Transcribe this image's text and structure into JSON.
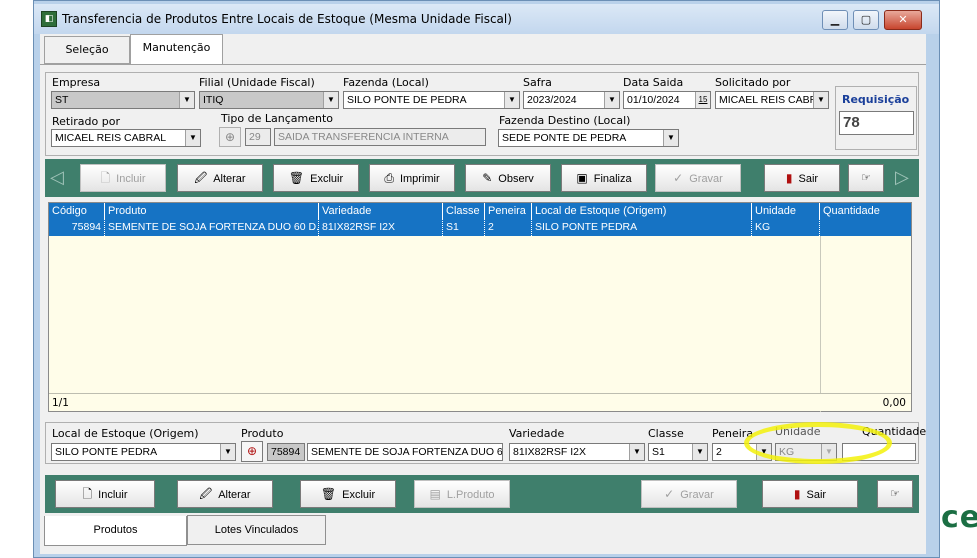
{
  "window": {
    "title": "Transferencia de Produtos Entre Locais de Estoque (Mesma Unidade Fiscal)",
    "minimize": "▁",
    "maximize": "▢",
    "close": "✕"
  },
  "tabs": [
    {
      "label": "Seleção"
    },
    {
      "label": "Manutenção"
    }
  ],
  "header": {
    "empresa": {
      "label": "Empresa",
      "value": "ST"
    },
    "filial": {
      "label": "Filial (Unidade Fiscal)",
      "value": "ITIQ"
    },
    "fazenda": {
      "label": "Fazenda (Local)",
      "value": "SILO PONTE DE PEDRA"
    },
    "safra": {
      "label": "Safra",
      "value": "2023/2024"
    },
    "data_saida": {
      "label": "Data Saida",
      "value": "01/10/2024",
      "cal": "15"
    },
    "solicitado": {
      "label": "Solicitado por",
      "value": "MICAEL REIS CABR"
    },
    "requisicao": {
      "label": "Requisição",
      "value": "78"
    },
    "retirado": {
      "label": "Retirado por",
      "value": "MICAEL REIS CABRAL"
    },
    "tipo": {
      "label": "Tipo de Lançamento",
      "code": "29",
      "value": "SAIDA TRANSFERENCIA INTERNA"
    },
    "destino": {
      "label": "Fazenda Destino  (Local)",
      "value": "SEDE PONTE DE PEDRA"
    }
  },
  "toolbar1": {
    "incluir": "Incluir",
    "alterar": "Alterar",
    "excluir": "Excluir",
    "imprimir": "Imprimir",
    "observ": "Observ",
    "finaliza": "Finaliza",
    "gravar": "Gravar",
    "sair": "Sair"
  },
  "grid": {
    "columns": [
      "Código",
      "Produto",
      "Variedade",
      "Classe",
      "Peneira",
      "Local de Estoque (Origem)",
      "Unidade",
      "Quantidade"
    ],
    "rows": [
      [
        "75894",
        "SEMENTE DE SOJA FORTENZA DUO 60 D...",
        "81IX82RSF I2X",
        "S1",
        "2",
        "SILO PONTE PEDRA",
        "KG",
        ""
      ]
    ],
    "record": "1/1",
    "total": "0,00"
  },
  "detail": {
    "local": {
      "label": "Local de Estoque (Origem)",
      "value": "SILO PONTE PEDRA"
    },
    "produto": {
      "label": "Produto",
      "code": "75894",
      "value": "SEMENTE DE SOJA FORTENZA DUO 60"
    },
    "variedade": {
      "label": "Variedade",
      "value": "81IX82RSF I2X"
    },
    "classe": {
      "label": "Classe",
      "value": "S1"
    },
    "peneira": {
      "label": "Peneira",
      "value": "2"
    },
    "unidade": {
      "label": "Unidade",
      "value": "KG"
    },
    "quantidade": {
      "label": "Quantidade",
      "value": ""
    }
  },
  "toolbar2": {
    "incluir": "Incluir",
    "alterar": "Alterar",
    "excluir": "Excluir",
    "lproduto": "L.Produto",
    "gravar": "Gravar",
    "sair": "Sair"
  },
  "bottom_tabs": [
    {
      "label": "Produtos"
    },
    {
      "label": "Lotes Vinculados"
    }
  ],
  "background_text": "ce",
  "colors": {
    "accent": "#3f7f6c",
    "selection": "#1673c4",
    "grid_bg": "#fffde9",
    "highlight": "#f3f10b"
  }
}
